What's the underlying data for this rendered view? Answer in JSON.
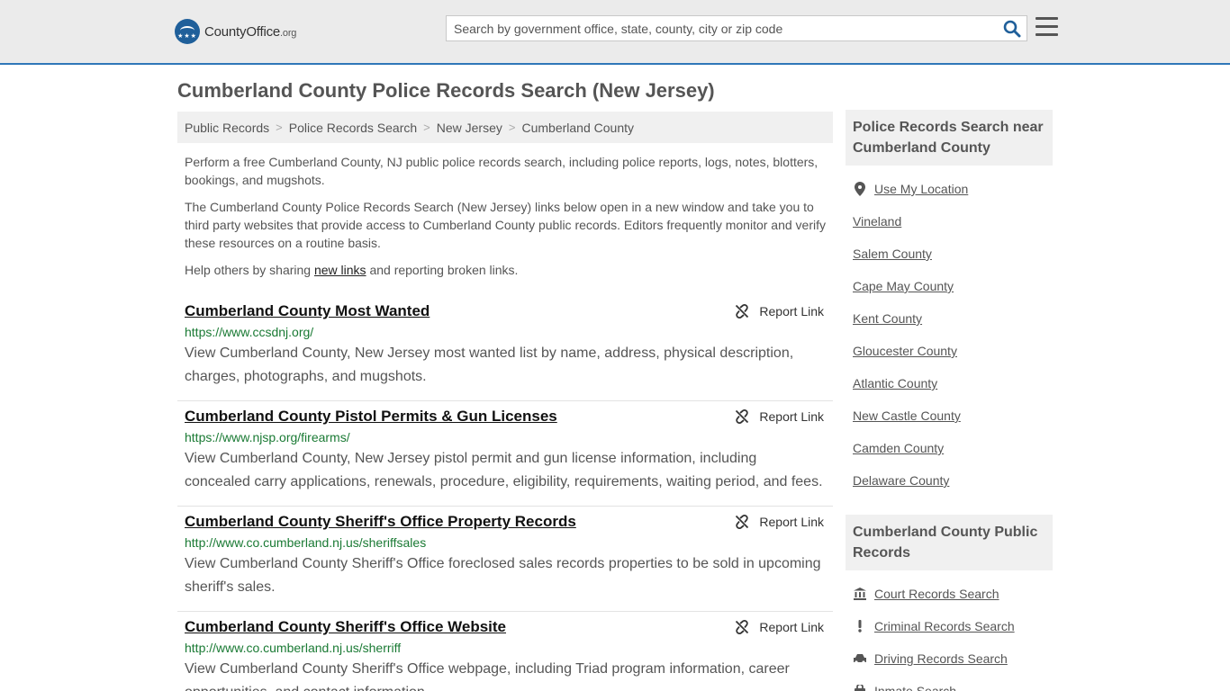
{
  "header": {
    "logo_main": "CountyOffice",
    "logo_suffix": ".org",
    "search_placeholder": "Search by government office, state, county, city or zip code"
  },
  "page_title": "Cumberland County Police Records Search (New Jersey)",
  "breadcrumb": [
    "Public Records",
    "Police Records Search",
    "New Jersey",
    "Cumberland County"
  ],
  "breadcrumb_sep": ">",
  "intro": {
    "p1": "Perform a free Cumberland County, NJ public police records search, including police reports, logs, notes, blotters, bookings, and mugshots.",
    "p2": "The Cumberland County Police Records Search (New Jersey) links below open in a new window and take you to third party websites that provide access to Cumberland County public records. Editors frequently monitor and verify these resources on a routine basis.",
    "p3_before": "Help others by sharing ",
    "p3_link": "new links",
    "p3_after": " and reporting broken links."
  },
  "report_label": "Report Link",
  "results": [
    {
      "title": "Cumberland County Most Wanted",
      "url": "https://www.ccsdnj.org/",
      "desc": "View Cumberland County, New Jersey most wanted list by name, address, physical description, charges, photographs, and mugshots."
    },
    {
      "title": "Cumberland County Pistol Permits & Gun Licenses",
      "url": "https://www.njsp.org/firearms/",
      "desc": "View Cumberland County, New Jersey pistol permit and gun license information, including concealed carry applications, renewals, procedure, eligibility, requirements, waiting period, and fees."
    },
    {
      "title": "Cumberland County Sheriff's Office Property Records",
      "url": "http://www.co.cumberland.nj.us/sheriffsales",
      "desc": "View Cumberland County Sheriff's Office foreclosed sales records properties to be sold in upcoming sheriff's sales."
    },
    {
      "title": "Cumberland County Sheriff's Office Website",
      "url": "http://www.co.cumberland.nj.us/sherriff",
      "desc": "View Cumberland County Sheriff's Office webpage, including Triad program information, career opportunities, and contact information."
    }
  ],
  "sidebar": {
    "near_title": "Police Records Search near Cumberland County",
    "use_location": "Use My Location",
    "near_items": [
      "Vineland",
      "Salem County",
      "Cape May County",
      "Kent County",
      "Gloucester County",
      "Atlantic County",
      "New Castle County",
      "Camden County",
      "Delaware County"
    ],
    "public_title": "Cumberland County Public Records",
    "public_items": [
      {
        "label": "Court Records Search",
        "icon": "courthouse-icon"
      },
      {
        "label": "Criminal Records Search",
        "icon": "exclamation-icon"
      },
      {
        "label": "Driving Records Search",
        "icon": "car-icon"
      },
      {
        "label": "Inmate Search",
        "icon": "inmate-icon"
      }
    ]
  },
  "colors": {
    "accent": "#2f77b8",
    "url_green": "#1a7a34",
    "header_bg": "#ebebeb",
    "panel_bg": "#f0f0f0"
  }
}
